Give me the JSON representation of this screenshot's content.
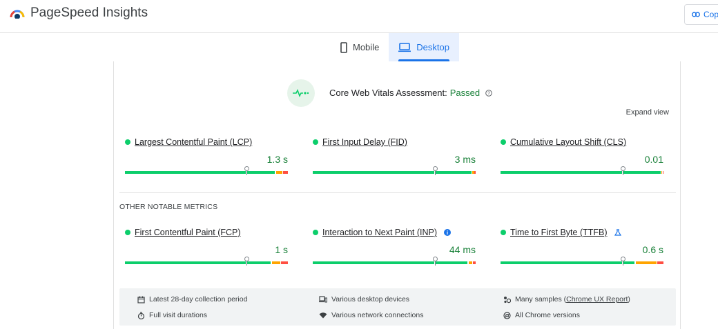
{
  "app": {
    "title": "PageSpeed Insights",
    "copy_label": "Cop"
  },
  "tabs": [
    {
      "label": "Mobile",
      "icon": "phone-icon",
      "active": false
    },
    {
      "label": "Desktop",
      "icon": "desktop-icon",
      "active": true
    }
  ],
  "cwv": {
    "title_prefix": "Core Web Vitals Assessment: ",
    "status": "Passed",
    "expand_label": "Expand view"
  },
  "core_metrics": [
    {
      "name": "Largest Contentful Paint (LCP)",
      "value": "1.3 s",
      "status": "good"
    },
    {
      "name": "First Input Delay (FID)",
      "value": "3 ms",
      "status": "good"
    },
    {
      "name": "Cumulative Layout Shift (CLS)",
      "value": "0.01",
      "status": "good"
    }
  ],
  "other_title": "OTHER NOTABLE METRICS",
  "other_metrics": [
    {
      "name": "First Contentful Paint (FCP)",
      "value": "1 s",
      "status": "good"
    },
    {
      "name": "Interaction to Next Paint (INP)",
      "value": "44 ms",
      "status": "good",
      "badge": "i"
    },
    {
      "name": "Time to First Byte (TTFB)",
      "value": "0.6 s",
      "status": "good",
      "badge": "experimental-icon"
    }
  ],
  "footer": {
    "period": "Latest 28-day collection period",
    "durations": "Full visit durations",
    "devices": "Various desktop devices",
    "network": "Various network connections",
    "samples_prefix": "Many samples (",
    "samples_link": "Chrome UX Report",
    "samples_suffix": ")",
    "versions": "All Chrome versions"
  },
  "colors": {
    "good": "#0cce6b",
    "needs_improvement": "#ffa400",
    "poor": "#ff4e42",
    "accent": "#1a73e8"
  }
}
